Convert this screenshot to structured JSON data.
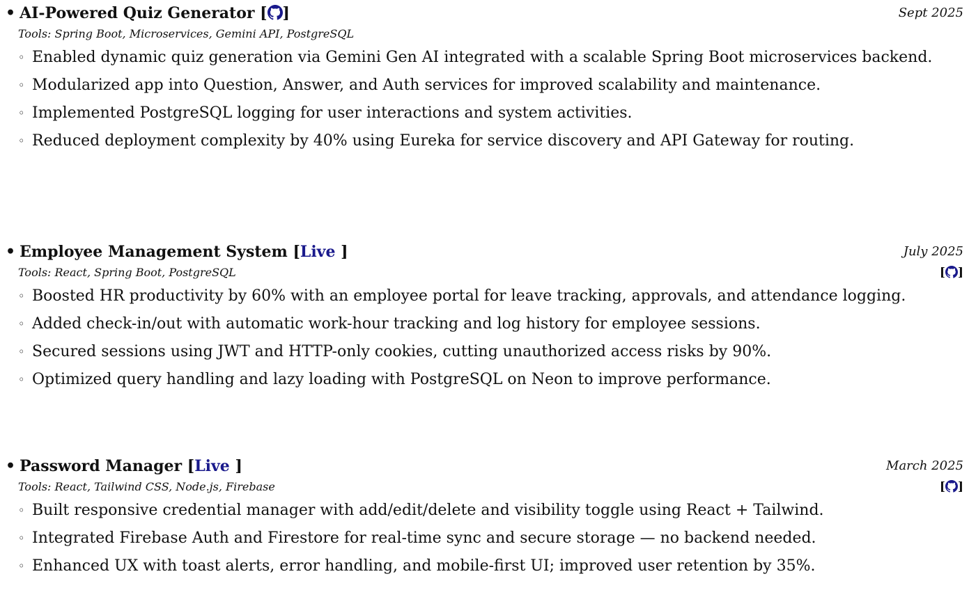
{
  "projects": [
    {
      "title": "AI-Powered Quiz Generator [",
      "title_close": "]",
      "date": "Sept 2025",
      "tools": "Tools: Spring Boot, Microservices, Gemini API, PostgreSQL",
      "title_icon": "github-icon",
      "bullets": [
        "Enabled dynamic quiz generation via Gemini Gen AI integrated with a scalable Spring Boot microservices backend.",
        "Modularized app into Question, Answer, and Auth services for improved scalability and maintenance.",
        "Implemented PostgreSQL logging for user interactions and system activities.",
        "Reduced deployment complexity by 40% using Eureka for service discovery and API Gateway for routing."
      ]
    },
    {
      "title": "Employee Management System [",
      "title_link": "Live",
      "title_close": " ]",
      "date": "July 2025",
      "tools": "Tools: React, Spring Boot, PostgreSQL",
      "side_open": "[",
      "side_close": "]",
      "side_icon": "github-icon",
      "bullets": [
        "Boosted HR productivity by 60% with an employee portal for leave tracking, approvals, and attendance logging.",
        "Added check-in/out with automatic work-hour tracking and log history for employee sessions.",
        "Secured sessions using JWT and HTTP-only cookies, cutting unauthorized access risks by 90%.",
        "Optimized query handling and lazy loading with PostgreSQL on Neon to improve performance."
      ]
    },
    {
      "title": "Password Manager [",
      "title_link": "Live",
      "title_close": " ]",
      "date": "March 2025",
      "tools": "Tools: React, Tailwind CSS, Node.js, Firebase",
      "side_open": "[",
      "side_close": "]",
      "side_icon": "github-icon",
      "bullets": [
        "Built responsive credential manager with add/edit/delete and visibility toggle using React + Tailwind.",
        "Integrated Firebase Auth and Firestore for real-time sync and secure storage — no backend needed.",
        "Enhanced UX with toast alerts, error handling, and mobile-first UI; improved user retention by 35%."
      ]
    }
  ],
  "colors": {
    "link": "#1a1a8c",
    "text": "#111111"
  }
}
